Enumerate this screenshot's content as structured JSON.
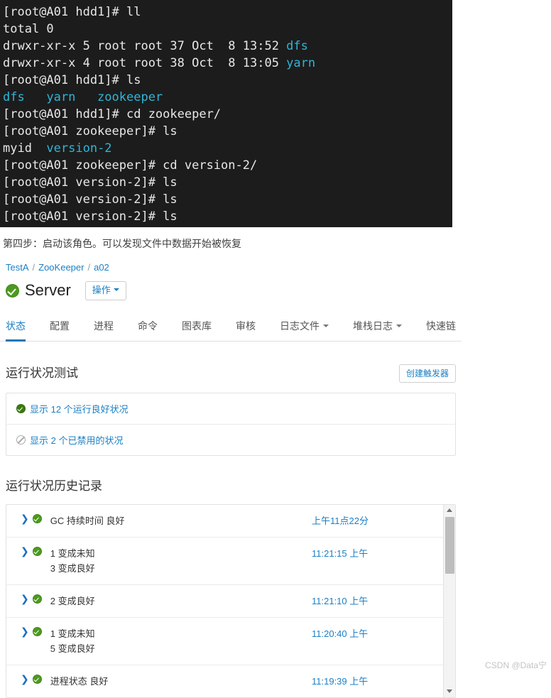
{
  "terminal": {
    "lines": [
      [
        {
          "t": "[root@A01 hdd1]# ll",
          "c": "w"
        }
      ],
      [
        {
          "t": "total 0",
          "c": "w"
        }
      ],
      [
        {
          "t": "drwxr-xr-x 5 root root 37 Oct  8 13:52 ",
          "c": "w"
        },
        {
          "t": "dfs",
          "c": "cy"
        }
      ],
      [
        {
          "t": "drwxr-xr-x 4 root root 38 Oct  8 13:05 ",
          "c": "w"
        },
        {
          "t": "yarn",
          "c": "cy"
        }
      ],
      [
        {
          "t": "[root@A01 hdd1]# ls",
          "c": "w"
        }
      ],
      [
        {
          "t": "dfs   yarn   zookeeper",
          "c": "cy"
        }
      ],
      [
        {
          "t": "[root@A01 hdd1]# cd zookeeper/",
          "c": "w"
        }
      ],
      [
        {
          "t": "[root@A01 zookeeper]# ls",
          "c": "w"
        }
      ],
      [
        {
          "t": "myid  ",
          "c": "w"
        },
        {
          "t": "version-2",
          "c": "cy"
        }
      ],
      [
        {
          "t": "[root@A01 zookeeper]# cd version-2/",
          "c": "w"
        }
      ],
      [
        {
          "t": "[root@A01 version-2]# ls",
          "c": "w"
        }
      ],
      [
        {
          "t": "[root@A01 version-2]# ls",
          "c": "w"
        }
      ],
      [
        {
          "t": "[root@A01 version-2]# ls",
          "c": "w"
        }
      ]
    ]
  },
  "caption": "第四步：启动该角色。可以发现文件中数据开始被恢复",
  "breadcrumb": {
    "items": [
      "TestA",
      "ZooKeeper",
      "a02"
    ],
    "separator": "/"
  },
  "header": {
    "status_icon": "circle-check-icon",
    "title": "Server",
    "action_button": "操作"
  },
  "tabs": [
    {
      "label": "状态",
      "active": true,
      "caret": false
    },
    {
      "label": "配置",
      "active": false,
      "caret": false
    },
    {
      "label": "进程",
      "active": false,
      "caret": false
    },
    {
      "label": "命令",
      "active": false,
      "caret": false
    },
    {
      "label": "图表库",
      "active": false,
      "caret": false
    },
    {
      "label": "审核",
      "active": false,
      "caret": false
    },
    {
      "label": "日志文件",
      "active": false,
      "caret": true
    },
    {
      "label": "堆栈日志",
      "active": false,
      "caret": true
    },
    {
      "label": "快速链",
      "active": false,
      "caret": false
    }
  ],
  "health_tests": {
    "title": "运行状况测试",
    "create_trigger_button": "创建触发器",
    "rows": [
      {
        "icon": "circle-check-icon",
        "label": "显示 12 个运行良好状况"
      },
      {
        "icon": "circle-ban-icon",
        "label": "显示 2 个已禁用的状况"
      }
    ]
  },
  "health_history": {
    "title": "运行状况历史记录",
    "rows": [
      {
        "icon": "circle-check-icon",
        "lines": [
          "GC 持续时间 良好"
        ],
        "time": "上午11点22分"
      },
      {
        "icon": "circle-check-icon",
        "lines": [
          "1 变成未知",
          "3 变成良好"
        ],
        "time": "11:21:15 上午"
      },
      {
        "icon": "circle-check-icon",
        "lines": [
          "2 变成良好"
        ],
        "time": "11:21:10 上午"
      },
      {
        "icon": "circle-check-icon",
        "lines": [
          "1 变成未知",
          "5 变成良好"
        ],
        "time": "11:20:40 上午"
      },
      {
        "icon": "circle-check-icon",
        "lines": [
          "进程状态 良好"
        ],
        "time": "11:19:39 上午"
      }
    ],
    "expand_chevron": "❯"
  },
  "watermark": "CSDN @Data宁",
  "colors": {
    "terminal_bg": "#1c1c1c",
    "terminal_fg": "#e8e8e8",
    "terminal_dir": "#2fb6d8",
    "link": "#1b7fc4",
    "accent": "#1278b5",
    "status_green": "#4c9a1e",
    "disabled_gray": "#aaaaaa"
  }
}
